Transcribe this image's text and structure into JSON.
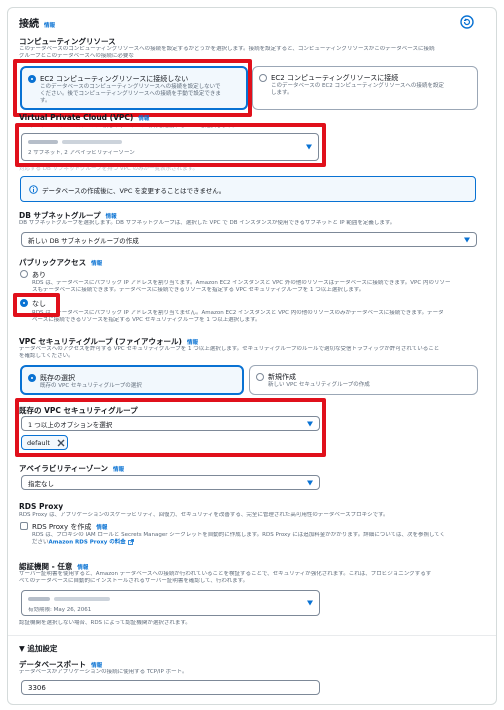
{
  "header": {
    "title": "接続",
    "info": "情報"
  },
  "compute": {
    "title": "コンピューティングリソース",
    "desc": "このデータベースのコンピューティングリソースへの接続を設定するかどうかを選択します。接続を設定すると、コンピューティングリソースがこのデータベースに接続",
    "desc2": "グループとこのデータベースへの接続に必要な",
    "option_no": {
      "title": "EC2 コンピューティングリソースに接続しない",
      "desc1": "このデータベースのコンピューティングリソースへの接続を設定しないで",
      "desc2": "ください。後でコンピューティングリソースへの接続を手動で設定できま",
      "desc3": "す。"
    },
    "option_yes": {
      "title": "EC2 コンピューティングリソースに接続",
      "desc1": "このデータベースの EC2 コンピューティングリソースへの接続を設定",
      "desc2": "します。"
    }
  },
  "vpc": {
    "title": "Virtual Private Cloud (VPC)",
    "info": "情報",
    "desc": "このデータベース インスタンスの仮想ネットワーク環境を定義する VPC を選択します。",
    "value_sub": "2 サブネット, 2 アベイラビリティーゾーン",
    "note": "対応する DB サブネットグループを持つ VPC のみが一覧表示されます。"
  },
  "alert": {
    "text": "データベースの作成後に、VPC を変更することはできません。"
  },
  "subnet": {
    "title": "DB サブネットグループ",
    "info": "情報",
    "desc": "DB サブネットグループを選択します。DB サブネットグループは、選択した VPC で DB インスタンスが使用できるサブネットと IP 範囲を定義します。",
    "value": "新しい DB サブネットグループの作成"
  },
  "public": {
    "title": "パブリックアクセス",
    "info": "情報",
    "yes_label": "あり",
    "yes_desc1": "RDS は、データベースにパブリック IP アドレスを割り当てます。Amazon EC2 インスタンスと VPC 外の他のリソースはデータベースに接続できます。VPC 内のリソー",
    "yes_desc2": "スもデータベースに接続できます。データベースに接続できるリソースを指定する VPC セキュリティグループを 1 つ以上選択します。",
    "no_label": "なし",
    "no_desc1": "RDS は、データベースにパブリック IP アドレスを割り当てません。Amazon EC2 インスタンスと VPC 内の他のリソースのみがデータベースに接続できます。データ",
    "no_desc2": "ベースに接続できるリソースを指定する VPC セキュリティグループを 1 つ以上選択します。"
  },
  "sg": {
    "title": "VPC セキュリティグループ (ファイアウォール)",
    "info": "情報",
    "desc1": "データベースへのアクセスを許可する VPC セキュリティグループを 1 つ以上選択します。セキュリティグループのルールで適切な受信トラフィックが許可されていること",
    "desc2": "を確認してください。",
    "existing_title": "既存の選択",
    "existing_desc": "既存の VPC セキュリティグループの選択",
    "new_title": "新規作成",
    "new_desc": "新しい VPC セキュリティグループの作成"
  },
  "existing_sg": {
    "title": "既存の VPC セキュリティグループ",
    "placeholder": "1 つ以上のオプションを選択",
    "token": "default"
  },
  "az": {
    "title": "アベイラビリティーゾーン",
    "info": "情報",
    "value": "指定なし"
  },
  "proxy": {
    "title": "RDS Proxy",
    "desc": "RDS Proxy は、アプリケーションのスケーラビリティ、回復力、セキュリティを改善する、完全に管理された高可用性のデータベースプロキシです。",
    "checkbox_label": "RDS Proxy を作成",
    "info": "情報",
    "cb_desc1": "RDS は、プロキシの IAM ロールと Secrets Manager シークレットを自動的に作成します。RDS Proxy には追加料金がかかります。詳細については、次を参照してく",
    "cb_desc2": "ださい",
    "link": "Amazon RDS Proxy の料金"
  },
  "cert": {
    "title": "認証機関 - 任意",
    "info": "情報",
    "desc1": "サーバー証明書を使用すると、Amazon データベースへの接続が行われていることを検証することで、セキュリティが強化されます。これは、プロビジョニングするす",
    "desc2": "べてのデータベースに自動的にインストールされるサーバー証明書を確認して、行われます。",
    "expiry": "有効期限: May 26, 2061",
    "note": "認証機関を選択しない場合、RDS によって認証機関が選択されます。"
  },
  "additional": {
    "title": "▼ 追加設定",
    "port_title": "データベースポート",
    "info": "情報",
    "port_desc": "データベースがアプリケーションの接続に使用する TCP/IP ポート。",
    "port_value": "3306"
  },
  "colors": {
    "accent": "#0972d3",
    "annotation": "#e0101b"
  }
}
